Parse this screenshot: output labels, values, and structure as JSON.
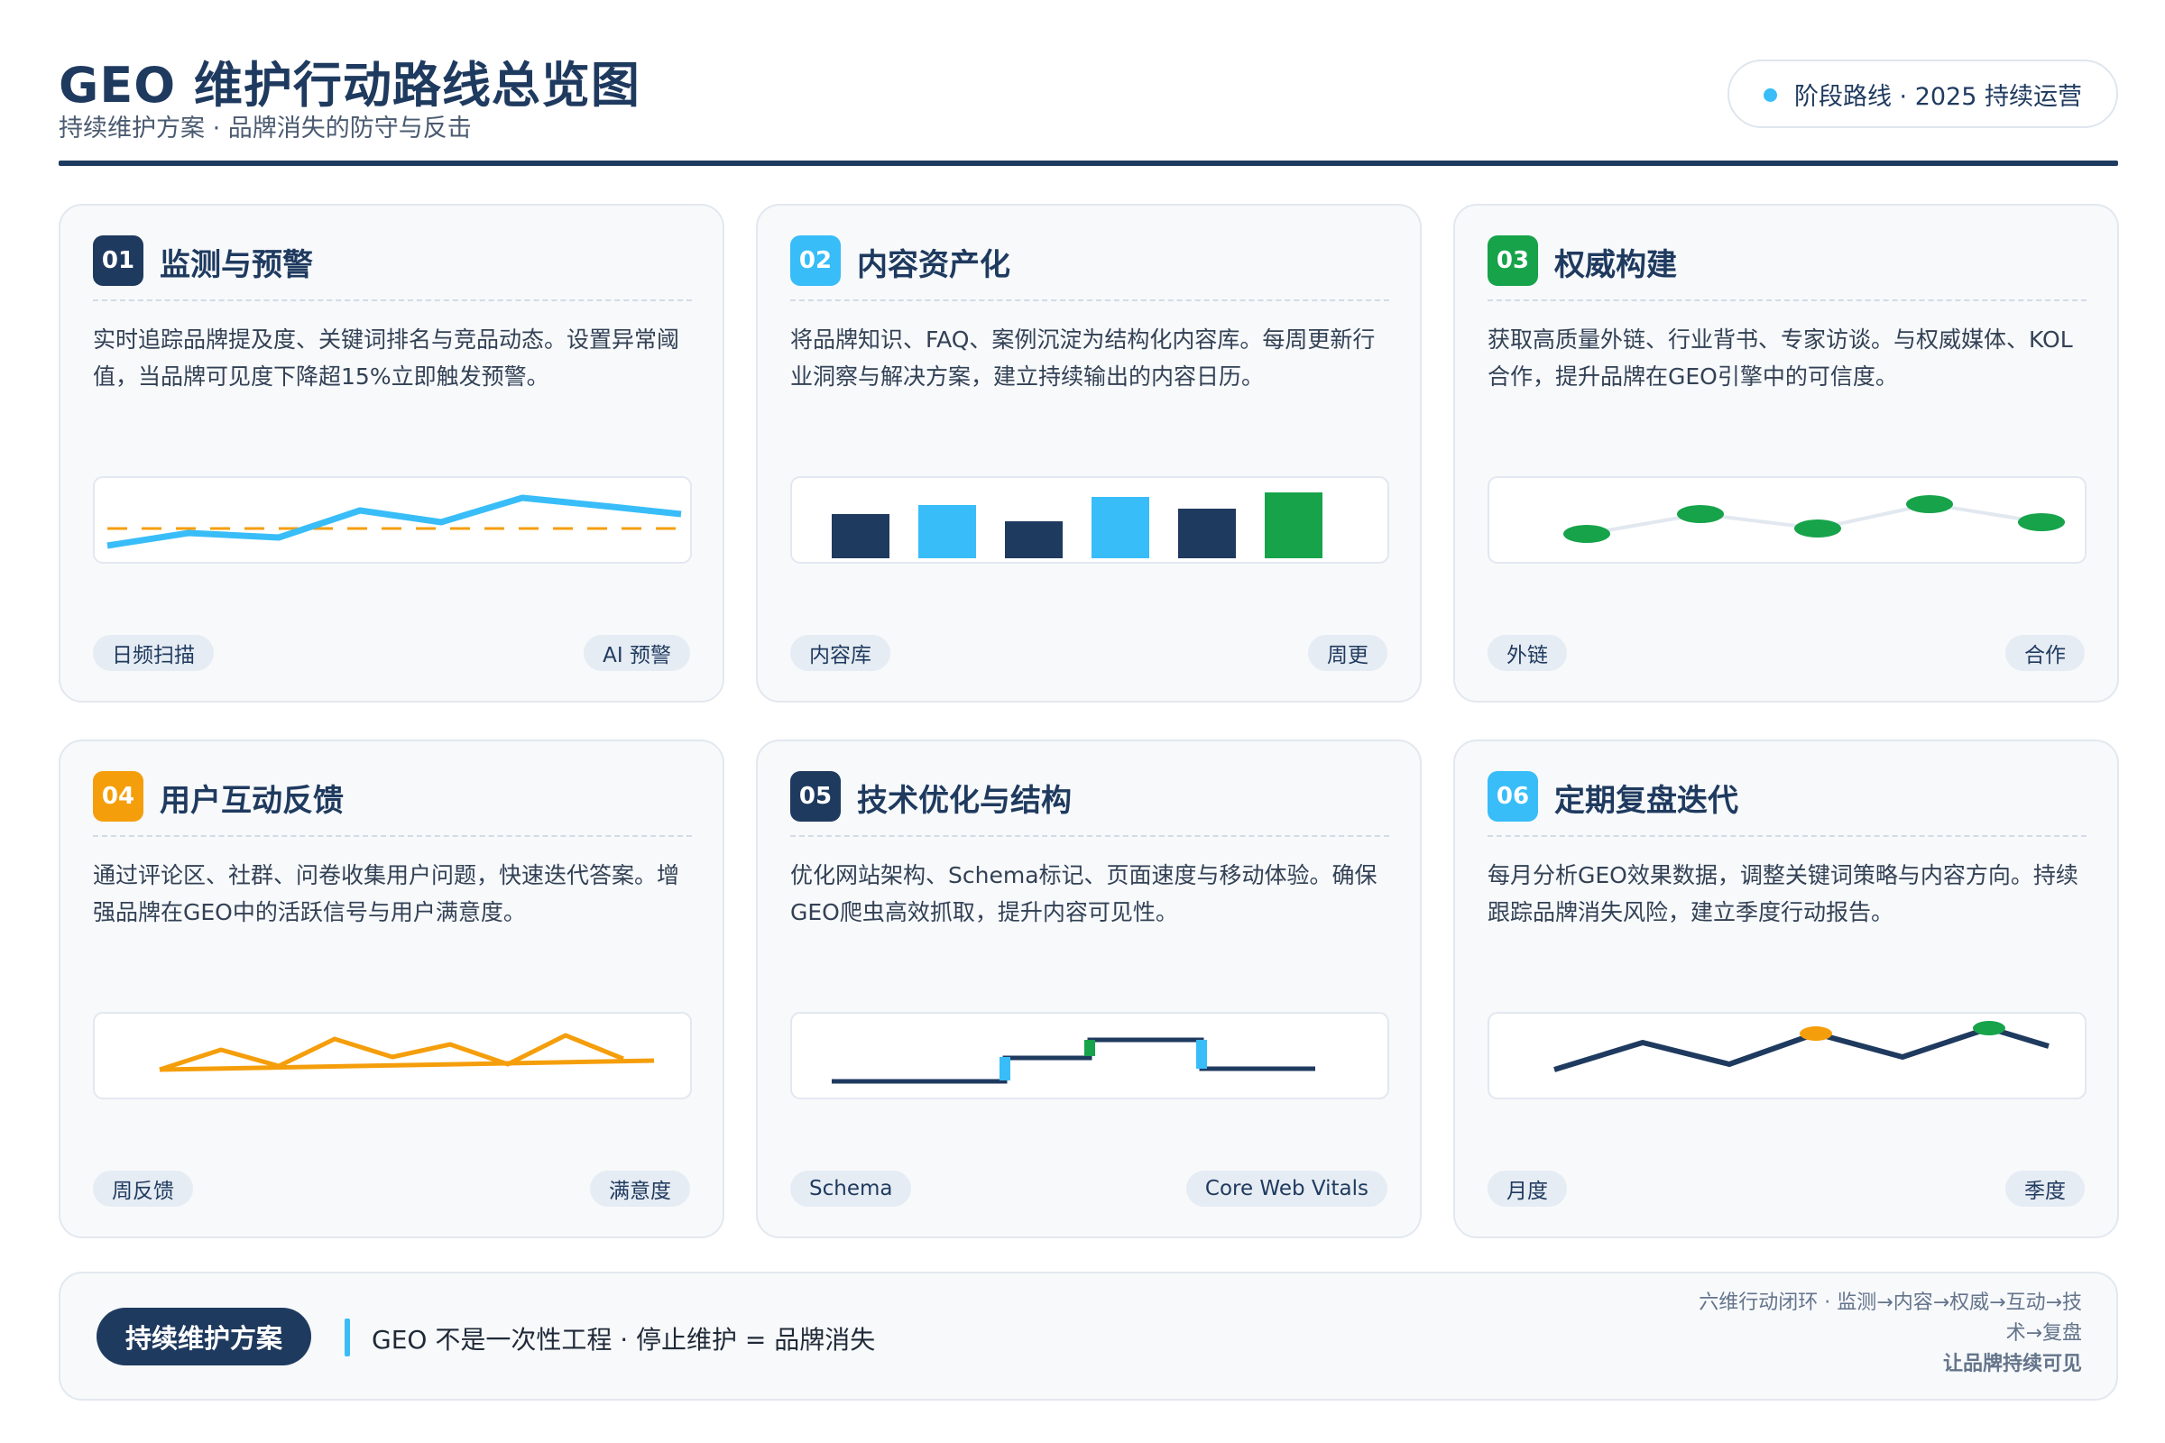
{
  "header": {
    "title": "GEO 维护行动路线总览图",
    "subtitle": "持续维护方案 · 品牌消失的防守与反击",
    "pill_text": "阶段路线 · 2025 持续运营"
  },
  "cards": [
    {
      "num": "01",
      "title": "监测与预警",
      "desc": "实时追踪品牌提及度、关键词排名与竞品动态。设置异常阈值，当品牌可见度下降超15%立即触发预警。",
      "tag_left": "日频扫描",
      "tag_right": "AI 预警",
      "badge_color": "#1f3a5f"
    },
    {
      "num": "02",
      "title": "内容资产化",
      "desc": "将品牌知识、FAQ、案例沉淀为结构化内容库。每周更新行业洞察与解决方案，建立持续输出的内容日历。",
      "tag_left": "内容库",
      "tag_right": "周更",
      "badge_color": "#38bdf8"
    },
    {
      "num": "03",
      "title": "权威构建",
      "desc": "获取高质量外链、行业背书、专家访谈。与权威媒体、KOL合作，提升品牌在GEO引擎中的可信度。",
      "tag_left": "外链",
      "tag_right": "合作",
      "badge_color": "#16a34a"
    },
    {
      "num": "04",
      "title": "用户互动反馈",
      "desc": "通过评论区、社群、问卷收集用户问题，快速迭代答案。增强品牌在GEO中的活跃信号与用户满意度。",
      "tag_left": "周反馈",
      "tag_right": "满意度",
      "badge_color": "#f59e0b"
    },
    {
      "num": "05",
      "title": "技术优化与结构",
      "desc": "优化网站架构、Schema标记、页面速度与移动体验。确保GEO爬虫高效抓取，提升内容可见性。",
      "tag_left": "Schema",
      "tag_right": "Core Web Vitals",
      "badge_color": "#1f3a5f"
    },
    {
      "num": "06",
      "title": "定期复盘迭代",
      "desc": "每月分析GEO效果数据，调整关键词策略与内容方向。持续跟踪品牌消失风险，建立季度行动报告。",
      "tag_left": "月度",
      "tag_right": "季度",
      "badge_color": "#38bdf8"
    }
  ],
  "footer": {
    "pill": "持续维护方案",
    "message": "GEO 不是一次性工程 · 停止维护 = 品牌消失",
    "right_text": "六维行动闭环 · 监测→内容→权威→互动→技术→复盘",
    "right_strong": "让品牌持续可见"
  },
  "colors": {
    "navy": "#1f3a5f",
    "sky": "#38bdf8",
    "green": "#16a34a",
    "amber": "#f59e0b"
  }
}
